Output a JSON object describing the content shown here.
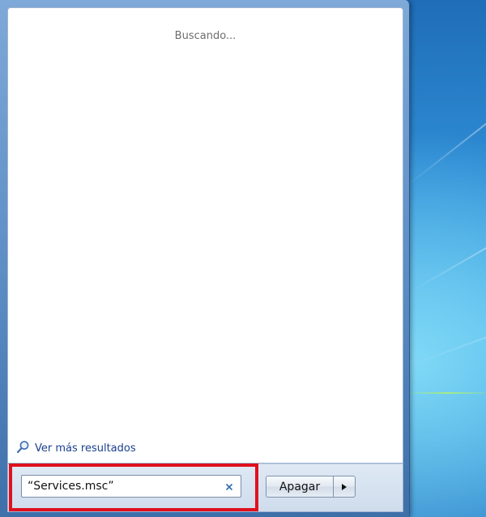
{
  "results": {
    "status_text": "Buscando...",
    "see_more_label": "Ver más resultados"
  },
  "search": {
    "value": "“Services.msc”",
    "clear_icon": "close-icon"
  },
  "power": {
    "shutdown_label": "Apagar",
    "arrow_icon": "arrow-right-icon"
  },
  "icons": {
    "see_more": "magnifier-icon"
  },
  "colors": {
    "highlight": "#e0101e",
    "link": "#1a3f8f",
    "status_text": "#6d6d6d"
  }
}
